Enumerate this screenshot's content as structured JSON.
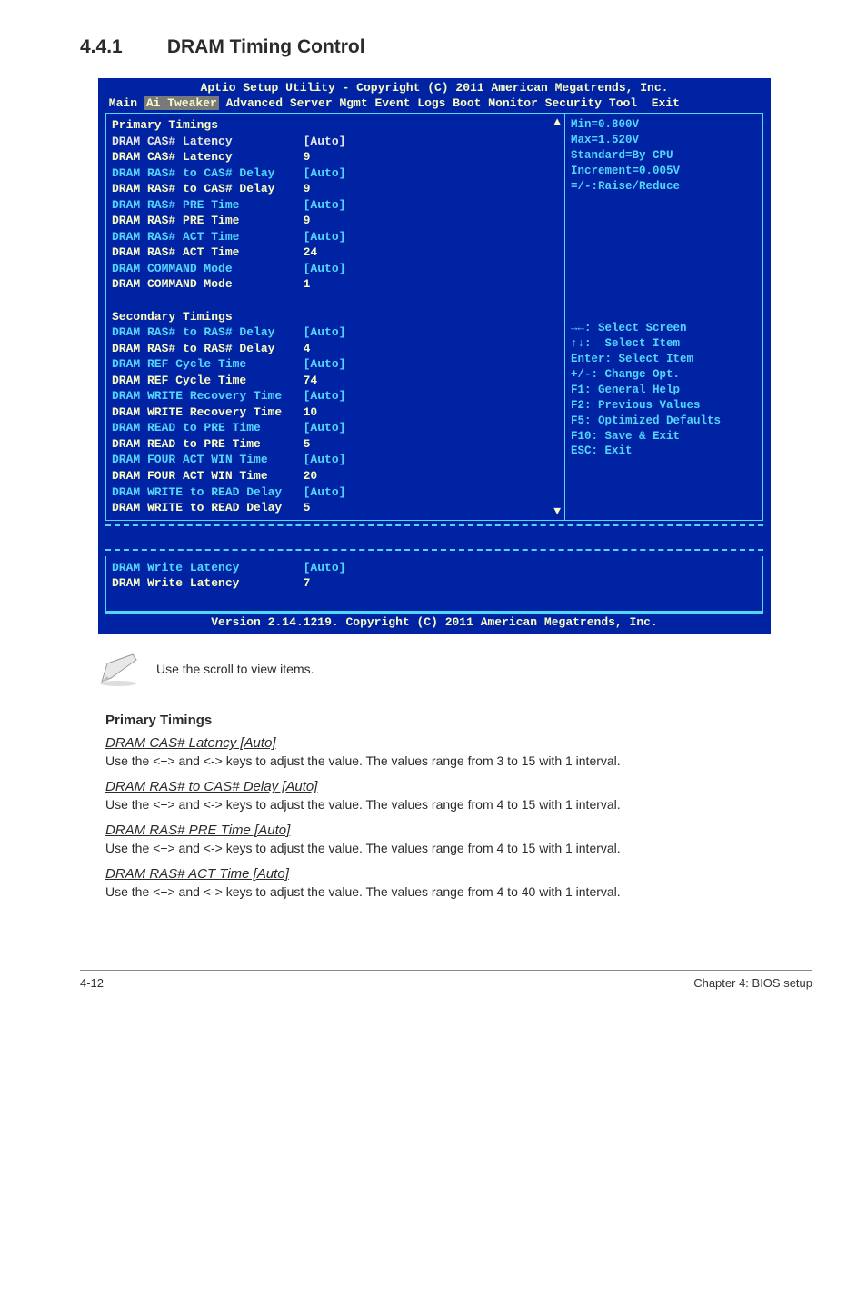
{
  "section_number": "4.4.1",
  "section_title": "DRAM Timing Control",
  "bios": {
    "title": "Aptio Setup Utility - Copyright (C) 2011 American Megatrends, Inc.",
    "tabs": {
      "pre": " Main ",
      "active": "Ai Tweaker",
      "post": " Advanced Server Mgmt Event Logs Boot Monitor Security Tool  Exit"
    },
    "primary_title": "Primary Timings",
    "secondary_title": "Secondary Timings",
    "primary": [
      {
        "label": "DRAM CAS# Latency",
        "value": "[Auto]",
        "style": "gray"
      },
      {
        "label": "DRAM CAS# Latency",
        "value": "9",
        "style": "lbl"
      },
      {
        "label": "DRAM RAS# to CAS# Delay",
        "value": "[Auto]",
        "style": "dcyan"
      },
      {
        "label": "DRAM RAS# to CAS# Delay",
        "value": "9",
        "style": "lbl"
      },
      {
        "label": "DRAM RAS# PRE Time",
        "value": "[Auto]",
        "style": "dcyan"
      },
      {
        "label": "DRAM RAS# PRE Time",
        "value": "9",
        "style": "lbl"
      },
      {
        "label": "DRAM RAS# ACT Time",
        "value": "[Auto]",
        "style": "dcyan"
      },
      {
        "label": "DRAM RAS# ACT Time",
        "value": "24",
        "style": "lbl"
      },
      {
        "label": "DRAM COMMAND Mode",
        "value": "[Auto]",
        "style": "dcyan"
      },
      {
        "label": "DRAM COMMAND Mode",
        "value": "1",
        "style": "lbl"
      }
    ],
    "secondary": [
      {
        "label": "DRAM RAS# to RAS# Delay",
        "value": "[Auto]",
        "style": "dcyan"
      },
      {
        "label": "DRAM RAS# to RAS# Delay",
        "value": "4",
        "style": "lbl"
      },
      {
        "label": "DRAM REF Cycle Time",
        "value": "[Auto]",
        "style": "dcyan"
      },
      {
        "label": "DRAM REF Cycle Time",
        "value": "74",
        "style": "lbl"
      },
      {
        "label": "DRAM WRITE Recovery Time",
        "value": "[Auto]",
        "style": "dcyan"
      },
      {
        "label": "DRAM WRITE Recovery Time",
        "value": "10",
        "style": "lbl"
      },
      {
        "label": "DRAM READ to PRE Time",
        "value": "[Auto]",
        "style": "dcyan"
      },
      {
        "label": "DRAM READ to PRE Time",
        "value": "5",
        "style": "lbl"
      },
      {
        "label": "DRAM FOUR ACT WIN Time",
        "value": "[Auto]",
        "style": "dcyan"
      },
      {
        "label": "DRAM FOUR ACT WIN Time",
        "value": "20",
        "style": "lbl"
      },
      {
        "label": "DRAM WRITE to READ Delay",
        "value": "[Auto]",
        "style": "dcyan"
      },
      {
        "label": "DRAM WRITE to READ Delay",
        "value": "5",
        "style": "lbl"
      }
    ],
    "lower": [
      {
        "label": "DRAM Write Latency",
        "value": "[Auto]",
        "style": "dcyan"
      },
      {
        "label": "DRAM Write Latency",
        "value": "7",
        "style": "lbl"
      }
    ],
    "help_top": [
      "Min=0.800V",
      "Max=1.520V",
      "Standard=By CPU",
      "Increment=0.005V",
      "=/-:Raise/Reduce"
    ],
    "help_bottom": [
      "→←: Select Screen",
      "↑↓:  Select Item",
      "Enter: Select Item",
      "+/-: Change Opt.",
      "F1: General Help",
      "F2: Previous Values",
      "F5: Optimized Defaults",
      "F10: Save & Exit",
      "ESC: Exit"
    ],
    "footer": "Version 2.14.1219. Copyright (C) 2011 American Megatrends, Inc."
  },
  "note": "Use the scroll to view items.",
  "content": {
    "heading": "Primary Timings",
    "items": [
      {
        "title": "DRAM CAS# Latency [Auto]",
        "text": "Use the <+> and <-> keys to adjust the value. The values range from 3 to 15 with 1 interval."
      },
      {
        "title": "DRAM RAS# to CAS# Delay [Auto]",
        "text": "Use the <+> and <-> keys to adjust the value. The values range from 4 to 15 with 1 interval."
      },
      {
        "title": "DRAM RAS# PRE Time [Auto]",
        "text": "Use the <+> and <-> keys to adjust the value. The values range from 4 to 15 with 1 interval."
      },
      {
        "title": "DRAM RAS# ACT Time [Auto]",
        "text": "Use the <+> and <-> keys to adjust the value. The values range from 4 to 40 with 1 interval."
      }
    ]
  },
  "page_footer": {
    "left": "4-12",
    "right": "Chapter 4: BIOS setup"
  }
}
